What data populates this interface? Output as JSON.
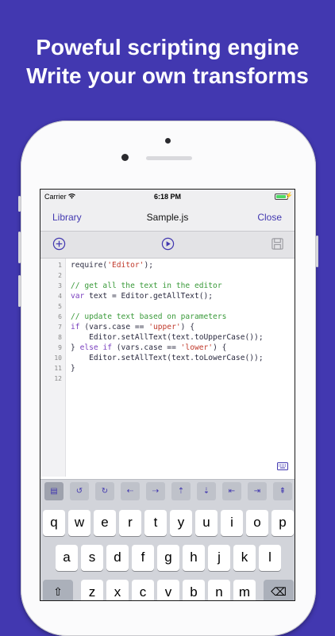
{
  "headline": {
    "line1": "Poweful scripting engine",
    "line2": "Write your own transforms"
  },
  "status": {
    "carrier": "Carrier",
    "time": "6:18 PM"
  },
  "nav": {
    "left": "Library",
    "title": "Sample.js",
    "right": "Close"
  },
  "editor": {
    "lines": [
      {
        "n": "1",
        "parts": [
          {
            "t": "require(",
            "c": ""
          },
          {
            "t": "'Editor'",
            "c": "str"
          },
          {
            "t": ");",
            "c": ""
          }
        ]
      },
      {
        "n": "2",
        "parts": []
      },
      {
        "n": "3",
        "parts": [
          {
            "t": "// get all the text in the editor",
            "c": "cm"
          }
        ]
      },
      {
        "n": "4",
        "parts": [
          {
            "t": "var",
            "c": "kw"
          },
          {
            "t": " text = Editor.getAllText();",
            "c": ""
          }
        ]
      },
      {
        "n": "5",
        "parts": []
      },
      {
        "n": "6",
        "parts": [
          {
            "t": "// update text based on parameters",
            "c": "cm"
          }
        ]
      },
      {
        "n": "7",
        "parts": [
          {
            "t": "if",
            "c": "kw"
          },
          {
            "t": " (vars.case == ",
            "c": ""
          },
          {
            "t": "'upper'",
            "c": "str"
          },
          {
            "t": ") {",
            "c": ""
          }
        ]
      },
      {
        "n": "8",
        "parts": [
          {
            "t": "    Editor.setAllText(text.toUpperCase());",
            "c": ""
          }
        ]
      },
      {
        "n": "9",
        "parts": [
          {
            "t": "} ",
            "c": ""
          },
          {
            "t": "else if",
            "c": "kw"
          },
          {
            "t": " (vars.case == ",
            "c": ""
          },
          {
            "t": "'lower'",
            "c": "str"
          },
          {
            "t": ") {",
            "c": ""
          }
        ]
      },
      {
        "n": "10",
        "parts": [
          {
            "t": "    Editor.setAllText(text.toLowerCase());",
            "c": ""
          }
        ]
      },
      {
        "n": "11",
        "parts": [
          {
            "t": "}",
            "c": ""
          }
        ]
      },
      {
        "n": "12",
        "parts": []
      }
    ]
  },
  "shortcut_keys": [
    {
      "label": "▤",
      "name": "tab-key-icon"
    },
    {
      "label": "↺",
      "name": "undo-icon"
    },
    {
      "label": "↻",
      "name": "redo-icon"
    },
    {
      "label": "⇠",
      "name": "cursor-left-icon"
    },
    {
      "label": "⇢",
      "name": "cursor-right-icon"
    },
    {
      "label": "⇡",
      "name": "cursor-up-icon"
    },
    {
      "label": "⇣",
      "name": "cursor-down-icon"
    },
    {
      "label": "⇤",
      "name": "line-start-icon"
    },
    {
      "label": "⇥",
      "name": "line-end-icon"
    },
    {
      "label": "⇞",
      "name": "page-up-icon"
    }
  ],
  "keyboard": {
    "row1": [
      "q",
      "w",
      "e",
      "r",
      "t",
      "y",
      "u",
      "i",
      "o",
      "p"
    ],
    "row2": [
      "a",
      "s",
      "d",
      "f",
      "g",
      "h",
      "j",
      "k",
      "l"
    ],
    "row3": [
      "⇧",
      "z",
      "x",
      "c",
      "v",
      "b",
      "n",
      "m",
      "⌫"
    ]
  },
  "colors": {
    "accent": "#4238b0",
    "background": "#4238b0",
    "battery": "#4cd964"
  },
  "battery_level": 0.9
}
